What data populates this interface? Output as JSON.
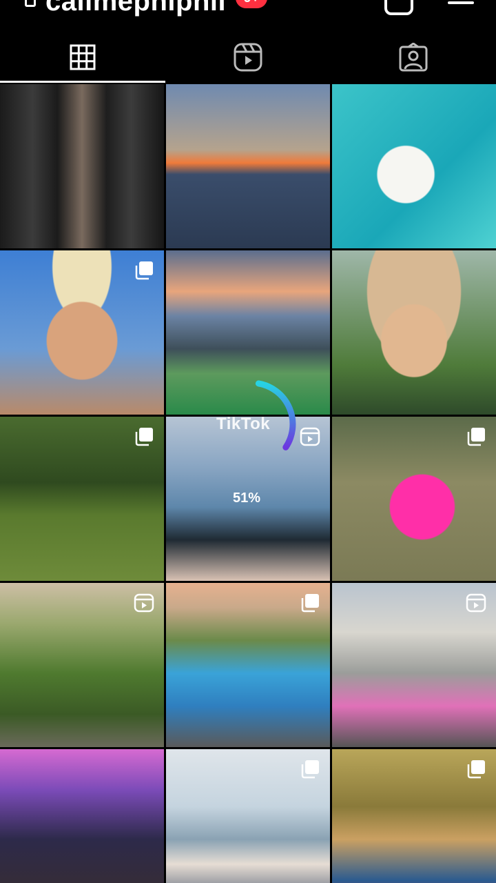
{
  "header": {
    "username": "callmephiphil",
    "notification_badge": "9+"
  },
  "tabs": [
    {
      "name": "posts-grid",
      "icon": "grid-icon",
      "active": true
    },
    {
      "name": "reels",
      "icon": "reels-icon",
      "active": false
    },
    {
      "name": "tagged",
      "icon": "tagged-user-icon",
      "active": false
    }
  ],
  "grid": {
    "posts": [
      {
        "index": 1,
        "overlay": "none"
      },
      {
        "index": 2,
        "overlay": "none"
      },
      {
        "index": 3,
        "overlay": "none"
      },
      {
        "index": 4,
        "overlay": "carousel-icon"
      },
      {
        "index": 5,
        "overlay": "none"
      },
      {
        "index": 6,
        "overlay": "none"
      },
      {
        "index": 7,
        "overlay": "carousel-icon"
      },
      {
        "index": 8,
        "overlay": "reel-icon"
      },
      {
        "index": 9,
        "overlay": "carousel-icon"
      },
      {
        "index": 10,
        "overlay": "reel-icon"
      },
      {
        "index": 11,
        "overlay": "carousel-icon"
      },
      {
        "index": 12,
        "overlay": "reel-icon"
      },
      {
        "index": 13,
        "overlay": "none"
      },
      {
        "index": 14,
        "overlay": "carousel-icon"
      },
      {
        "index": 15,
        "overlay": "carousel-icon"
      }
    ]
  },
  "loader": {
    "brand": "TikTok",
    "progress_text": "51%",
    "progress": 0.51
  },
  "colors": {
    "background": "#000000",
    "badge": "#ff3040",
    "loader_start": "#27d3e2",
    "loader_end": "#6c37e0"
  }
}
